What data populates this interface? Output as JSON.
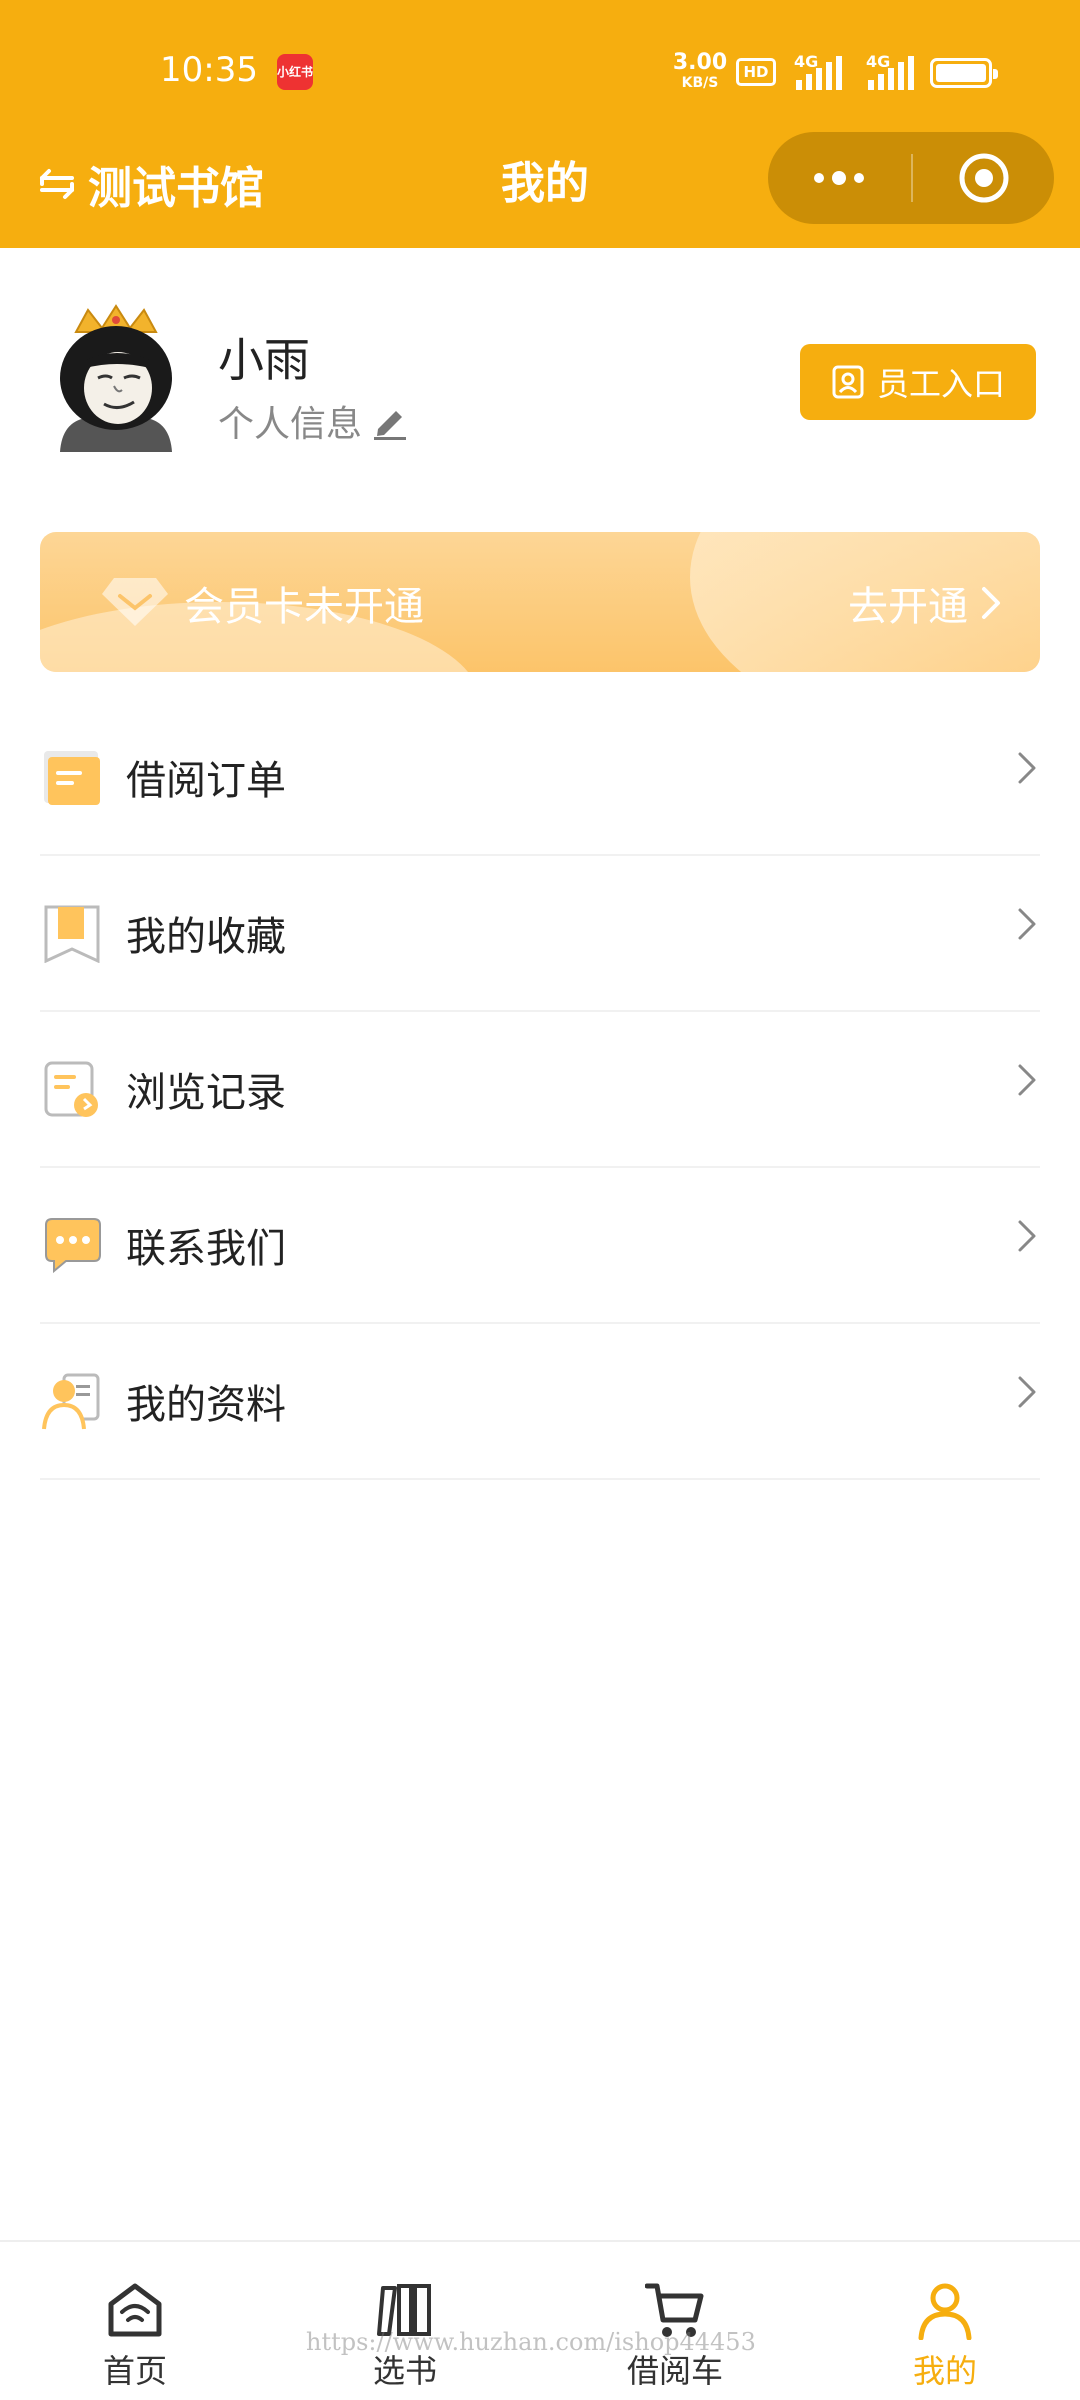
{
  "status_bar": {
    "time": "10:35",
    "app_badge": "小红书",
    "net_speed_value": "3.00",
    "net_speed_unit": "KB/S",
    "hd_label": "HD",
    "signal1_label": "4G",
    "signal2_label": "4G",
    "battery_level": 1.0
  },
  "nav": {
    "back_label": "测试书馆",
    "title": "我的"
  },
  "profile": {
    "name": "小雨",
    "info_label": "个人信息",
    "staff_button": "员工入口"
  },
  "member_card": {
    "status": "会员卡未开通",
    "action": "去开通"
  },
  "menu": {
    "items": [
      {
        "label": "借阅订单",
        "icon": "order-icon"
      },
      {
        "label": "我的收藏",
        "icon": "bookmark-icon"
      },
      {
        "label": "浏览记录",
        "icon": "history-icon"
      },
      {
        "label": "联系我们",
        "icon": "chat-icon"
      },
      {
        "label": "我的资料",
        "icon": "profile-icon"
      }
    ]
  },
  "tabbar": {
    "tabs": [
      {
        "label": "首页",
        "icon": "home-icon"
      },
      {
        "label": "选书",
        "icon": "books-icon"
      },
      {
        "label": "借阅车",
        "icon": "cart-icon"
      },
      {
        "label": "我的",
        "icon": "user-icon",
        "active": true
      }
    ]
  },
  "watermark": "https://www.huzhan.com/ishop44453",
  "colors": {
    "accent": "#f6ae0f",
    "capsule": "#cb8e06",
    "card": "#fcc46a",
    "icon_orange": "#ffc45c"
  }
}
